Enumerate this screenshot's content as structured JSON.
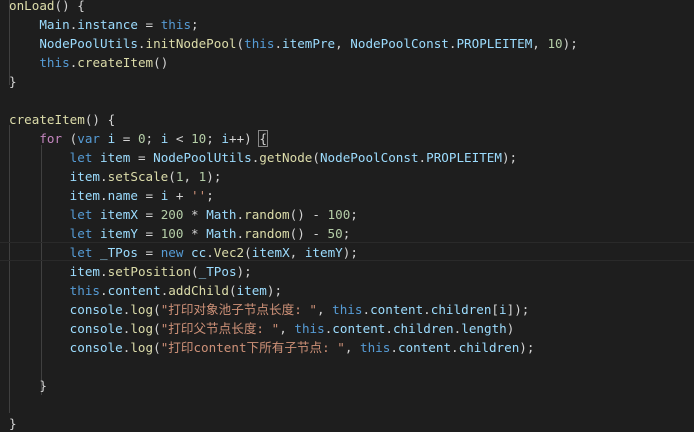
{
  "editor": {
    "lines": [
      [
        [
          "onLoad",
          "fn"
        ],
        [
          "() {",
          "pun"
        ]
      ],
      [
        [
          "    ",
          "pun"
        ],
        [
          "Main",
          "var"
        ],
        [
          ".",
          "pun"
        ],
        [
          "instance",
          "var"
        ],
        [
          " = ",
          "pun"
        ],
        [
          "this",
          "kw"
        ],
        [
          ";",
          "pun"
        ]
      ],
      [
        [
          "    ",
          "pun"
        ],
        [
          "NodePoolUtils",
          "var"
        ],
        [
          ".",
          "pun"
        ],
        [
          "initNodePool",
          "fn"
        ],
        [
          "(",
          "pun"
        ],
        [
          "this",
          "kw"
        ],
        [
          ".",
          "pun"
        ],
        [
          "itemPre",
          "var"
        ],
        [
          ", ",
          "pun"
        ],
        [
          "NodePoolConst",
          "var"
        ],
        [
          ".",
          "pun"
        ],
        [
          "PROPLEITEM",
          "var"
        ],
        [
          ", ",
          "pun"
        ],
        [
          "10",
          "num"
        ],
        [
          ");",
          "pun"
        ]
      ],
      [
        [
          "    ",
          "pun"
        ],
        [
          "this",
          "kw"
        ],
        [
          ".",
          "pun"
        ],
        [
          "createItem",
          "fn"
        ],
        [
          "()",
          "pun"
        ]
      ],
      [
        [
          "}",
          "pun"
        ]
      ],
      [],
      [
        [
          "createItem",
          "fn"
        ],
        [
          "() {",
          "pun"
        ]
      ],
      [
        [
          "    ",
          "pun"
        ],
        [
          "for",
          "ctrl"
        ],
        [
          " (",
          "pun"
        ],
        [
          "var",
          "kw"
        ],
        [
          " ",
          "pun"
        ],
        [
          "i",
          "var"
        ],
        [
          " = ",
          "pun"
        ],
        [
          "0",
          "num"
        ],
        [
          "; ",
          "pun"
        ],
        [
          "i",
          "var"
        ],
        [
          " < ",
          "pun"
        ],
        [
          "10",
          "num"
        ],
        [
          "; ",
          "pun"
        ],
        [
          "i",
          "var"
        ],
        [
          "++) ",
          "pun"
        ],
        [
          "{",
          "pun"
        ]
      ],
      [
        [
          "        ",
          "pun"
        ],
        [
          "let",
          "kw"
        ],
        [
          " ",
          "pun"
        ],
        [
          "item",
          "var"
        ],
        [
          " = ",
          "pun"
        ],
        [
          "NodePoolUtils",
          "var"
        ],
        [
          ".",
          "pun"
        ],
        [
          "getNode",
          "fn"
        ],
        [
          "(",
          "pun"
        ],
        [
          "NodePoolConst",
          "var"
        ],
        [
          ".",
          "pun"
        ],
        [
          "PROPLEITEM",
          "var"
        ],
        [
          ");",
          "pun"
        ]
      ],
      [
        [
          "        ",
          "pun"
        ],
        [
          "item",
          "var"
        ],
        [
          ".",
          "pun"
        ],
        [
          "setScale",
          "fn"
        ],
        [
          "(",
          "pun"
        ],
        [
          "1",
          "num"
        ],
        [
          ", ",
          "pun"
        ],
        [
          "1",
          "num"
        ],
        [
          ");",
          "pun"
        ]
      ],
      [
        [
          "        ",
          "pun"
        ],
        [
          "item",
          "var"
        ],
        [
          ".",
          "pun"
        ],
        [
          "name",
          "var"
        ],
        [
          " = ",
          "pun"
        ],
        [
          "i",
          "var"
        ],
        [
          " + ",
          "pun"
        ],
        [
          "''",
          "str"
        ],
        [
          ";",
          "pun"
        ]
      ],
      [
        [
          "        ",
          "pun"
        ],
        [
          "let",
          "kw"
        ],
        [
          " ",
          "pun"
        ],
        [
          "itemX",
          "var"
        ],
        [
          " = ",
          "pun"
        ],
        [
          "200",
          "num"
        ],
        [
          " * ",
          "pun"
        ],
        [
          "Math",
          "var"
        ],
        [
          ".",
          "pun"
        ],
        [
          "random",
          "fn"
        ],
        [
          "() - ",
          "pun"
        ],
        [
          "100",
          "num"
        ],
        [
          ";",
          "pun"
        ]
      ],
      [
        [
          "        ",
          "pun"
        ],
        [
          "let",
          "kw"
        ],
        [
          " ",
          "pun"
        ],
        [
          "itemY",
          "var"
        ],
        [
          " = ",
          "pun"
        ],
        [
          "100",
          "num"
        ],
        [
          " * ",
          "pun"
        ],
        [
          "Math",
          "var"
        ],
        [
          ".",
          "pun"
        ],
        [
          "random",
          "fn"
        ],
        [
          "() - ",
          "pun"
        ],
        [
          "50",
          "num"
        ],
        [
          ";",
          "pun"
        ]
      ],
      [
        [
          "        ",
          "pun"
        ],
        [
          "let",
          "kw"
        ],
        [
          " ",
          "pun"
        ],
        [
          "_TPos",
          "var"
        ],
        [
          " = ",
          "pun"
        ],
        [
          "new",
          "kw"
        ],
        [
          " ",
          "pun"
        ],
        [
          "cc",
          "var"
        ],
        [
          ".",
          "pun"
        ],
        [
          "Vec2",
          "fn"
        ],
        [
          "(",
          "pun"
        ],
        [
          "itemX",
          "var"
        ],
        [
          ", ",
          "pun"
        ],
        [
          "itemY",
          "var"
        ],
        [
          ");",
          "pun"
        ]
      ],
      [
        [
          "        ",
          "pun"
        ],
        [
          "item",
          "var"
        ],
        [
          ".",
          "pun"
        ],
        [
          "setPosition",
          "fn"
        ],
        [
          "(",
          "pun"
        ],
        [
          "_TPos",
          "var"
        ],
        [
          ");",
          "pun"
        ]
      ],
      [
        [
          "        ",
          "pun"
        ],
        [
          "this",
          "kw"
        ],
        [
          ".",
          "pun"
        ],
        [
          "content",
          "var"
        ],
        [
          ".",
          "pun"
        ],
        [
          "addChild",
          "fn"
        ],
        [
          "(",
          "pun"
        ],
        [
          "item",
          "var"
        ],
        [
          ");",
          "pun"
        ]
      ],
      [
        [
          "        ",
          "pun"
        ],
        [
          "console",
          "var"
        ],
        [
          ".",
          "pun"
        ],
        [
          "log",
          "fn"
        ],
        [
          "(",
          "pun"
        ],
        [
          "\"打印对象池子节点长度: \"",
          "str"
        ],
        [
          ", ",
          "pun"
        ],
        [
          "this",
          "kw"
        ],
        [
          ".",
          "pun"
        ],
        [
          "content",
          "var"
        ],
        [
          ".",
          "pun"
        ],
        [
          "children",
          "var"
        ],
        [
          "[",
          "pun"
        ],
        [
          "i",
          "var"
        ],
        [
          "]);",
          "pun"
        ]
      ],
      [
        [
          "        ",
          "pun"
        ],
        [
          "console",
          "var"
        ],
        [
          ".",
          "pun"
        ],
        [
          "log",
          "fn"
        ],
        [
          "(",
          "pun"
        ],
        [
          "\"打印父节点长度: \"",
          "str"
        ],
        [
          ", ",
          "pun"
        ],
        [
          "this",
          "kw"
        ],
        [
          ".",
          "pun"
        ],
        [
          "content",
          "var"
        ],
        [
          ".",
          "pun"
        ],
        [
          "children",
          "var"
        ],
        [
          ".",
          "pun"
        ],
        [
          "length",
          "var"
        ],
        [
          ")",
          "pun"
        ]
      ],
      [
        [
          "        ",
          "pun"
        ],
        [
          "console",
          "var"
        ],
        [
          ".",
          "pun"
        ],
        [
          "log",
          "fn"
        ],
        [
          "(",
          "pun"
        ],
        [
          "\"打印content下所有子节点: \"",
          "str"
        ],
        [
          ", ",
          "pun"
        ],
        [
          "this",
          "kw"
        ],
        [
          ".",
          "pun"
        ],
        [
          "content",
          "var"
        ],
        [
          ".",
          "pun"
        ],
        [
          "children",
          "var"
        ],
        [
          ");",
          "pun"
        ]
      ],
      [],
      [
        [
          "    ",
          "pun"
        ],
        [
          "}",
          "pun"
        ]
      ],
      [],
      [
        [
          "}",
          "pun"
        ]
      ]
    ]
  }
}
